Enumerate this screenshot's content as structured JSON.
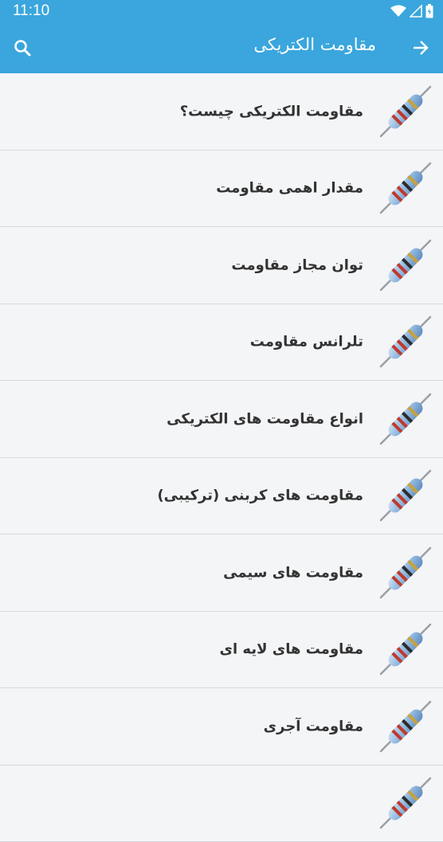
{
  "status_bar": {
    "time": "11:10",
    "icons": [
      "wifi-icon",
      "signal-icon",
      "battery-icon"
    ]
  },
  "app_bar": {
    "title": "مقاومت الکتریکی",
    "back_icon": "arrow-right-icon",
    "search_icon": "search-icon",
    "background": "#3aa6dd"
  },
  "list": {
    "items": [
      {
        "label": "مقاومت الکتریکی چیست؟",
        "icon": "resistor-icon"
      },
      {
        "label": "مقدار اهمی مقاومت",
        "icon": "resistor-icon"
      },
      {
        "label": "توان مجاز مقاومت",
        "icon": "resistor-icon"
      },
      {
        "label": "تلرانس مقاومت",
        "icon": "resistor-icon"
      },
      {
        "label": "انواع مقاومت های الکتریکی",
        "icon": "resistor-icon"
      },
      {
        "label": "مقاومت های کربنی (ترکیبی)",
        "icon": "resistor-icon"
      },
      {
        "label": "مقاومت های سیمی",
        "icon": "resistor-icon"
      },
      {
        "label": "مقاومت های لایه ای",
        "icon": "resistor-icon"
      },
      {
        "label": "مقاومت آجری",
        "icon": "resistor-icon"
      },
      {
        "label": "",
        "icon": "resistor-icon"
      }
    ]
  }
}
